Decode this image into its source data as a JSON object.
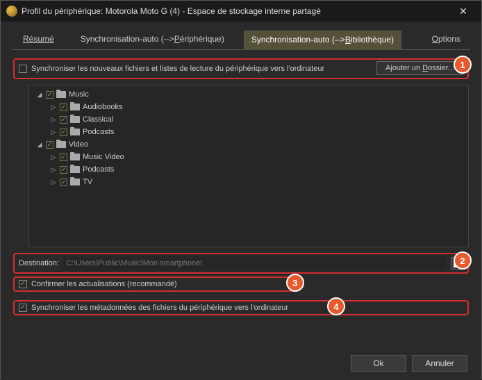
{
  "title": "Profil du périphérique: Motorola Moto G (4) - Espace de stockage interne partagé",
  "tabs": {
    "resume": "Résumé",
    "sync_out_pre": "Synchronisation-auto (-->",
    "sync_out_u": "P",
    "sync_out_post": "ériphérique)",
    "sync_in_pre": "Synchronisation-auto (-->",
    "sync_in_u": "B",
    "sync_in_post": "ibliothèque)",
    "options_u": "O",
    "options_post": "ptions"
  },
  "sync_top_label": "Synchroniser les nouveaux fichiers et listes de lecture du périphérique vers l'ordinateur",
  "add_folder_pre": "Ajouter un ",
  "add_folder_u": "D",
  "add_folder_post": "ossier...",
  "tree": {
    "music": "Music",
    "audiobooks": "Audiobooks",
    "classical": "Classical",
    "podcasts": "Podcasts",
    "video": "Video",
    "music_video": "Music Video",
    "podcasts2": "Podcasts",
    "tv": "TV"
  },
  "dest_label": "Destination:",
  "dest_value": "C:\\Users\\Public\\Music\\Mon smartphone\\",
  "confirm_label": "Confirmer les actualisations (recommandé)",
  "meta_label": "Synchroniser les métadonnées des fichiers du périphérique vers l'ordinateur",
  "ok": "Ok",
  "cancel": "Annuler",
  "b1": "1",
  "b2": "2",
  "b3": "3",
  "b4": "4"
}
